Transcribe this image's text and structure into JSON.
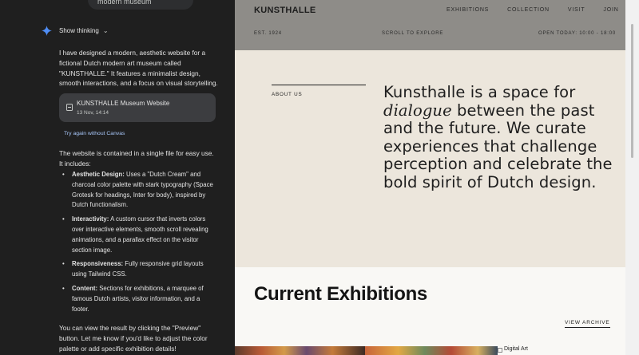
{
  "chat": {
    "previous_message": "modern museum",
    "thinking_label": "Show thinking",
    "intro": "I have designed a modern, aesthetic website for a fictional Dutch modern art museum called \"KUNSTHALLE.\" It features a minimalist design, smooth interactions, and a focus on visual storytelling.",
    "canvas_card": {
      "title": "KUNSTHALLE Museum Website",
      "date": "13 Nov, 14:14",
      "icon": "document-icon"
    },
    "try_again": "Try again without Canvas",
    "contained": "The website is contained in a single file for easy use. It includes:",
    "bullets": [
      {
        "label": "Aesthetic Design:",
        "text": " Uses a \"Dutch Cream\" and charcoal color palette with stark typography (Space Grotesk for headings, Inter for body), inspired by Dutch functionalism."
      },
      {
        "label": "Interactivity:",
        "text": " A custom cursor that inverts colors over interactive elements, smooth scroll revealing animations, and a parallax effect on the visitor section image."
      },
      {
        "label": "Responsiveness:",
        "text": " Fully responsive grid layouts using Tailwind CSS."
      },
      {
        "label": "Content:",
        "text": " Sections for exhibitions, a marquee of famous Dutch artists, visitor information, and a footer."
      }
    ],
    "closing": "You can view the result by clicking the \"Preview\" button. Let me know if you'd like to adjust the color palette or add specific exhibition details!"
  },
  "site": {
    "logo": "KUNSTHALLE",
    "nav": [
      "EXHIBITIONS",
      "COLLECTION",
      "VISIT",
      "JOIN"
    ],
    "hero": {
      "est": "EST. 1924",
      "scroll": "SCROLL TO EXPLORE",
      "open": "OPEN TODAY: 10:00 - 18:00"
    },
    "about": {
      "label": "ABOUT US",
      "text_before": "Kunsthalle is a space for ",
      "emphasis": "dialogue",
      "text_after": " between the past and the future. We curate experiences that challenge perception and celebrate the bold spirit of Dutch design."
    },
    "exhibitions": {
      "title": "Current Exhibitions",
      "view_archive": "VIEW ARCHIVE",
      "broken_image_alt": "Digital Art"
    }
  },
  "colors": {
    "chat_bg": "#1f1f1f",
    "hero_overlay": "#8e8c88",
    "dutch_cream": "#ece6dc",
    "charcoal": "#1e1e1e",
    "link_blue": "#a8c7fa"
  }
}
